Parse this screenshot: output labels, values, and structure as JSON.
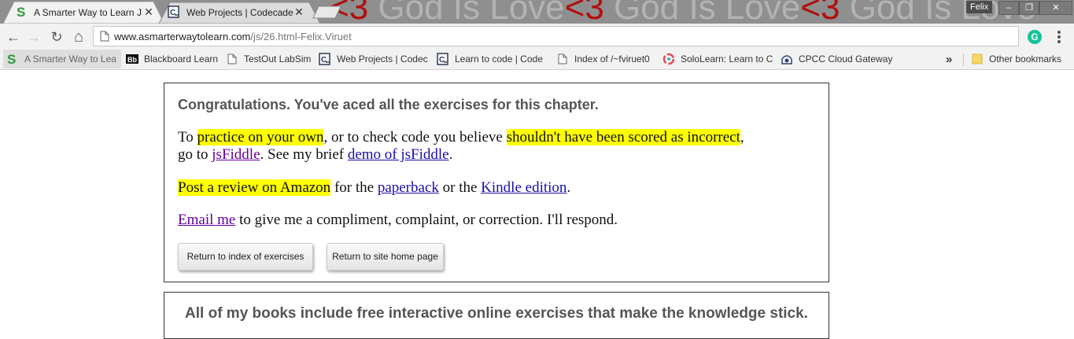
{
  "browser": {
    "tabs": [
      {
        "title": "A Smarter Way to Learn J",
        "active": true,
        "icon": "s-logo-icon",
        "icon_color": "#2d9a3c"
      },
      {
        "title": "Web Projects | Codecade",
        "active": false,
        "icon": "codecademy-icon"
      }
    ],
    "theme_text": {
      "heart": "<3",
      "phrase": " God Is Love"
    },
    "user_name": "Felix",
    "window_controls": {
      "minimize": "–",
      "restore": "❐",
      "close": "✕"
    },
    "toolbar": {
      "back": "←",
      "forward": "→",
      "reload": "↻",
      "home": "⌂",
      "url_domain": "www.asmarterwaytolearn.com",
      "url_path": "/js/26.html-Felix.Viruet",
      "extension_letter": "G",
      "extension_color": "#15c39a"
    },
    "bookmarks": {
      "items": [
        {
          "label": "A Smarter Way to Lea",
          "icon": "s-logo-icon"
        },
        {
          "label": "Blackboard Learn",
          "icon": "blackboard-icon"
        },
        {
          "label": "TestOut LabSim",
          "icon": "page-icon"
        },
        {
          "label": "Web Projects | Codec",
          "icon": "codecademy-icon"
        },
        {
          "label": "Learn to code | Code",
          "icon": "codecademy-icon"
        },
        {
          "label": "Index of /~fviruet0",
          "icon": "page-icon"
        },
        {
          "label": "SoloLearn: Learn to C",
          "icon": "sololearn-icon"
        },
        {
          "label": "CPCC Cloud Gateway",
          "icon": "cloud-gateway-icon"
        }
      ],
      "overflow": "»",
      "other": "Other bookmarks"
    }
  },
  "page": {
    "congrats": "Congratulations. You've aced all the exercises for this chapter.",
    "p1": {
      "t1": "To ",
      "h1": "practice on your own",
      "t2": ", or to check code you believe ",
      "h2": "shouldn't have been scored as incorrect",
      "t3": ",",
      "t4": "go to ",
      "link1": "jsFiddle",
      "t5": ". See my brief ",
      "link2": "demo of jsFiddle",
      "t6": "."
    },
    "p2": {
      "h1": "Post a review on Amazon",
      "t1": " for the ",
      "link1": "paperback",
      "t2": " or the ",
      "link2": "Kindle edition",
      "t3": "."
    },
    "p3": {
      "link1": "Email me",
      "t1": " to give me a compliment, complaint, or correction. I'll respond."
    },
    "buttons": {
      "index": "Return to index of exercises",
      "home": "Return to site home page"
    },
    "books_line": "All of my books include free interactive online exercises that make the knowledge stick.",
    "highlight_color": "#ffff00",
    "link_color": "#1a0dab",
    "visited_link_color": "#660099"
  }
}
